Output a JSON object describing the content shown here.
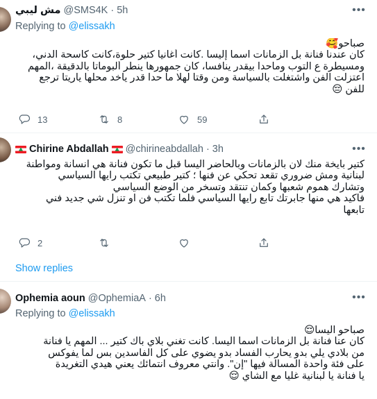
{
  "tweets": [
    {
      "name": "مش ليبي",
      "handle": "@SMS4K",
      "time": "5h",
      "reply_to": "@elissakh",
      "body": [
        "صباحو🥰",
        "كان عندنا فنانة بل الزمانات اسما إليسا .كانت أغانيا كتير حلوة،كانت كاسحة الدني،",
        "ومسيطرة ع التوب وماحدا بيقدر ينافسا، كان جمهورها ينطر ألبوماتا بالدقيقة ،المهم",
        "اعتزلت الفن واشتغلت بالسياسة ومن وقتا لهلا ما حدا قدر ياخد محلها ياريتا ترجع",
        "للفن 😔"
      ],
      "replies": "13",
      "retweets": "8",
      "likes": "59"
    },
    {
      "name": "Chirine Abdallah",
      "handle": "@chirineabdallah",
      "time": "3h",
      "body": [
        "كتير بايخة منك لان بالزمانات وبالحاضر اليسا قبل ما تكون فنانة هي انسانة ومواطنة",
        "لبنانية ومش ضروري تقعد تحكي عن فنها ؛ كتير طبيعي تكتب رايها السياسي",
        "وتشارك هموم شعبها وكمان تنتقد وتسخر من الوضع السياسي",
        "فاكيد هي منها جابرتك تابع رايها السياسي فلما تكتب فن او تنزل شي جديد فني",
        "تابعها"
      ],
      "replies": "2",
      "retweets": "",
      "likes": ""
    },
    {
      "name": "Ophemia aoun",
      "handle": "@OphemiaA",
      "time": "6h",
      "reply_to": "@elissakh",
      "body": [
        "صباحو اليسا😌",
        "كان عنا فنانة بل الزمانات اسما اليسا. كانت تغني بلاي باك كتير ... المهم يا فنانة",
        "من بلادي  يلي بدو يحارب الفساد بدو يضوي على كل الفاسدين بس لما يفوكس",
        "على فئة  واحدة  المسألة  فيها \"إن\". وانتي معروف انتمائك    يعني هيدي التغريدة",
        "يا فنانة يا لبنانية غليا مع الشاي 😌"
      ]
    }
  ],
  "labels": {
    "replying_to": "Replying to",
    "show_replies": "Show replies",
    "separator": "·"
  },
  "icons": [
    "more-icon",
    "reply-icon",
    "retweet-icon",
    "like-icon",
    "share-icon",
    "lebanon-flag-icon"
  ],
  "colors": {
    "link": "#1d9bf0",
    "secondary_text": "#536471",
    "divider": "#eff3f4"
  }
}
